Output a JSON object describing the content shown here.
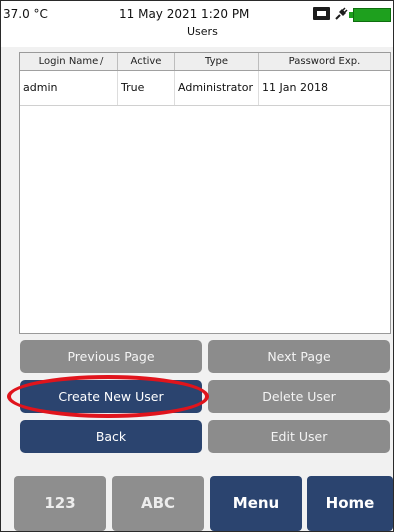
{
  "status": {
    "temperature": "37.0 °C",
    "datetime": "11 May 2021 1:20 PM",
    "screen_title": "Users",
    "icons": [
      "usb-drive-icon",
      "plug-icon",
      "battery-icon"
    ],
    "battery_color": "#1ea01e"
  },
  "table": {
    "headers": [
      "Login Name",
      "Active",
      "Type",
      "Password Exp."
    ],
    "sort_indicator": "/",
    "rows": [
      [
        "admin",
        "True",
        "Administrator",
        "11 Jan 2018"
      ]
    ]
  },
  "buttons": {
    "previous_page": "Previous Page",
    "next_page": "Next Page",
    "create_new_user": "Create New User",
    "delete_user": "Delete User",
    "back": "Back",
    "edit_user": "Edit User"
  },
  "keys": {
    "numeric": "123",
    "alpha": "ABC",
    "menu": "Menu",
    "home": "Home"
  },
  "colors": {
    "navy": "#2b446f",
    "disabled_gray": "#8c8c8c",
    "highlight_red": "#e0141c"
  }
}
